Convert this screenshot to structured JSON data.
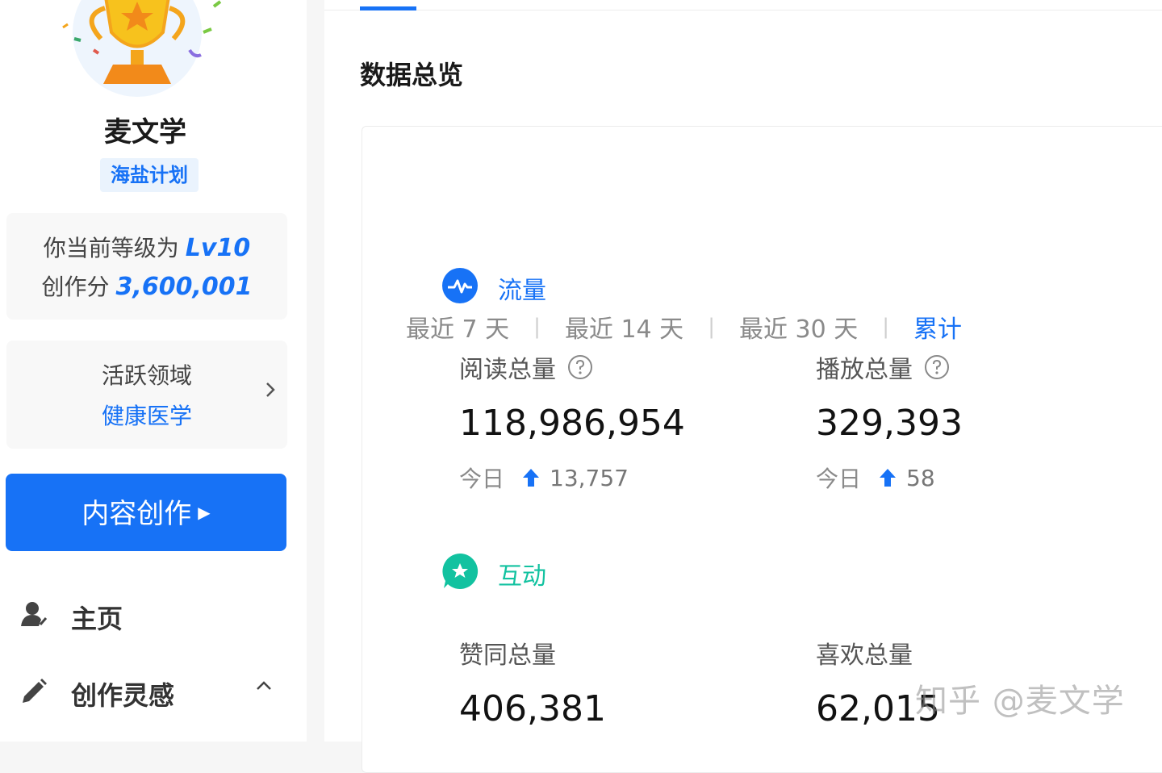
{
  "sidebar": {
    "user_name": "麦文学",
    "plan_badge": "海盐计划",
    "level": {
      "level_prefix": "你当前等级为",
      "level_value": "Lv10",
      "score_prefix": "创作分",
      "score_value": "3,600,001"
    },
    "domain": {
      "title": "活跃领域",
      "value": "健康医学"
    },
    "create_button": "内容创作",
    "nav": [
      {
        "label": "主页",
        "icon": "user-icon"
      },
      {
        "label": "创作灵感",
        "icon": "pencil-icon",
        "expanded": true
      }
    ]
  },
  "main": {
    "section_title": "数据总览",
    "period_tabs": [
      {
        "label": "最近 7 天",
        "active": false
      },
      {
        "label": "最近 14 天",
        "active": false
      },
      {
        "label": "最近 30 天",
        "active": false
      },
      {
        "label": "累计",
        "active": true
      }
    ],
    "groups": [
      {
        "label": "流量",
        "icon": "pulse-icon",
        "color": "#1772f6",
        "metrics": [
          {
            "label": "阅读总量",
            "value": "118,986,954",
            "today_label": "今日",
            "today_value": "13,757"
          },
          {
            "label": "播放总量",
            "value": "329,393",
            "today_label": "今日",
            "today_value": "58"
          }
        ]
      },
      {
        "label": "互动",
        "icon": "star-bubble-icon",
        "color": "#12c2a0",
        "metrics": [
          {
            "label": "赞同总量",
            "value": "406,381"
          },
          {
            "label": "喜欢总量",
            "value": "62,015"
          }
        ]
      }
    ]
  },
  "watermark": "知乎 @麦文学",
  "colors": {
    "accent": "#1772f6",
    "interaction": "#12c2a0"
  }
}
